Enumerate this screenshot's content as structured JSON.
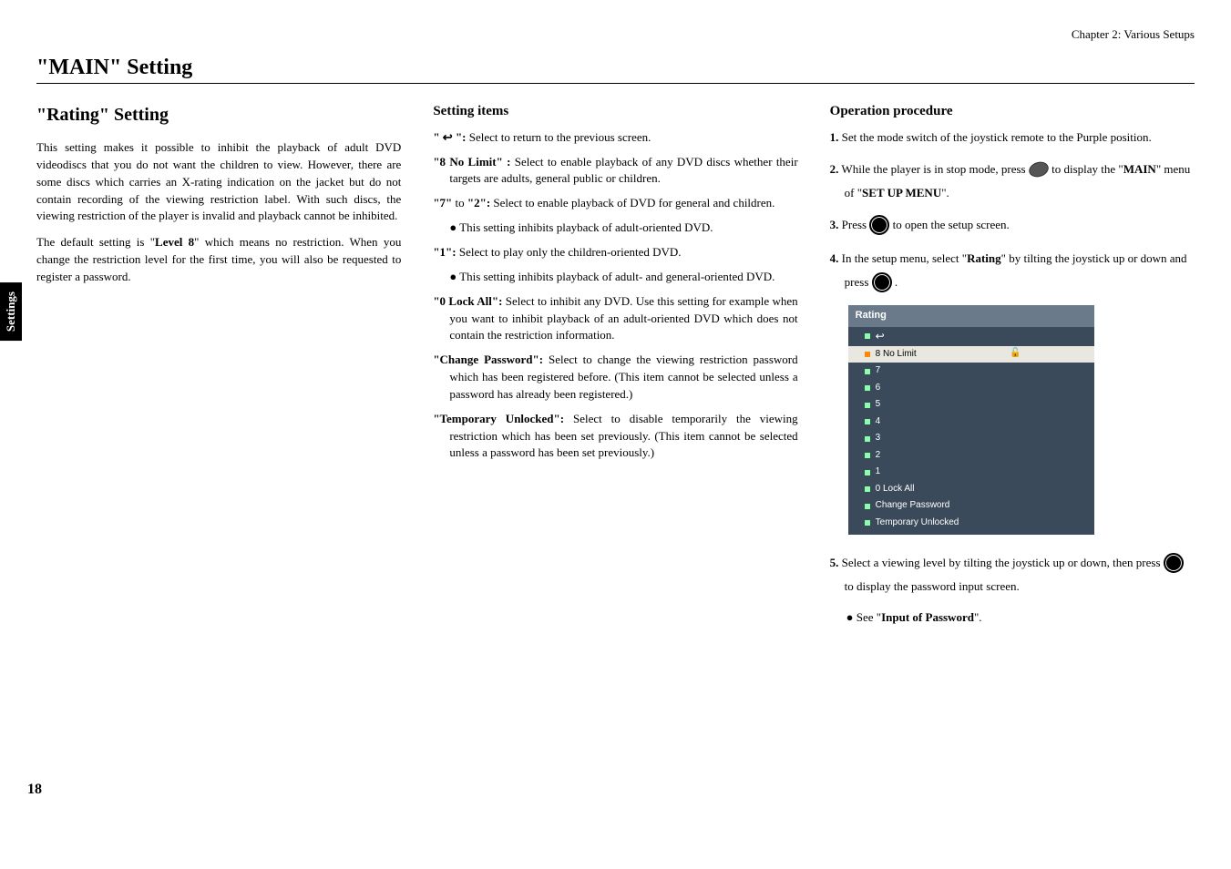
{
  "chapter": "Chapter 2: Various Setups",
  "sideTab": "Settings",
  "pageNumber": "18",
  "mainTitle": "\"MAIN\" Setting",
  "col1": {
    "subtitle": "\"Rating\" Setting",
    "p1": "This setting makes it possible to inhibit the playback of adult DVD videodiscs that you do not want the children to view. However, there are some discs which carries an X-rating indication on the jacket but do not contain recording of the viewing restriction label. With such discs, the viewing restriction of the player is invalid and playback cannot be inhibited.",
    "p2a": "The default setting is \"",
    "p2bold": "Level 8",
    "p2b": "\" which means no restriction. When you change the restriction level for the first time, you will also be requested to register a password."
  },
  "col2": {
    "heading": "Setting items",
    "i1": {
      "label": "\" ↩ \":",
      "text": " Select to return to the previous screen."
    },
    "i2": {
      "label": "\"8 No Limit\" :",
      "text": " Select to enable playback of any DVD discs whether their targets are adults, general public or children."
    },
    "i3": {
      "label": "\"7\" ",
      "mid": "to",
      "label2": " \"2\":",
      "text": " Select to enable playback of DVD for general and children."
    },
    "i3b": "● This setting inhibits playback of adult-oriented DVD.",
    "i4": {
      "label": "\"1\":",
      "text": " Select to play only the children-oriented DVD."
    },
    "i4b": "● This setting inhibits playback of adult- and general-oriented DVD.",
    "i5": {
      "label": "\"0 Lock All\":",
      "text": "  Select to inhibit any DVD. Use this setting for example when you want to inhibit playback of an adult-oriented DVD which does not contain the restriction information."
    },
    "i6": {
      "label": "\"Change Password\":",
      "text": " Select to change the viewing restriction password which has been registered before. (This item cannot be selected unless a password has already been registered.)"
    },
    "i7": {
      "label": "\"Temporary Unlocked\":",
      "text": " Select to disable temporarily the viewing restriction which has been set previously. (This item cannot be selected unless a password has been set previously.)"
    }
  },
  "col3": {
    "heading": "Operation procedure",
    "s1": {
      "n": "1.",
      "t": " Set the mode switch of the joystick remote to the Purple position."
    },
    "s2": {
      "n": "2.",
      "t1": " While the player is in stop mode, press ",
      "t2": " to display the \"",
      "b1": "MAIN",
      "t3": "\" menu of \"",
      "b2": "SET UP MENU",
      "t4": "\"."
    },
    "s3": {
      "n": "3.",
      "t1": " Press ",
      "t2": " to open the setup screen."
    },
    "s4": {
      "n": "4.",
      "t1": " In the setup menu, select \"",
      "b1": "Rating",
      "t2": "\" by tilting the joystick up or down and press ",
      "t3": " ."
    },
    "menu": {
      "title": "Rating",
      "rows": [
        "↩",
        "8 No Limit",
        "7",
        "6",
        "5",
        "4",
        "3",
        "2",
        "1",
        "0 Lock All",
        "Change Password",
        "Temporary Unlocked"
      ]
    },
    "s5": {
      "n": "5.",
      "t1": " Select a viewing level by tilting the joystick up or down, then press ",
      "t2": " to display the password input screen."
    },
    "s5b": {
      "pre": "● See \"",
      "bold": "Input of Password",
      "post": "\"."
    }
  }
}
